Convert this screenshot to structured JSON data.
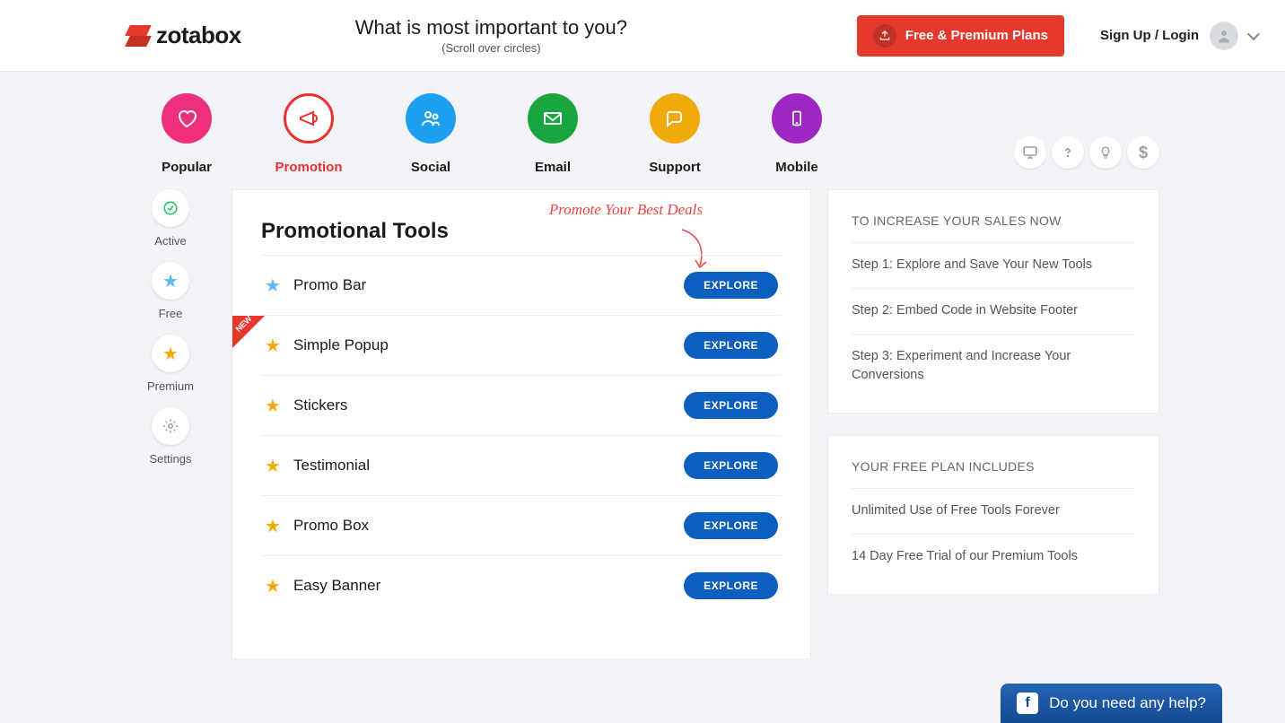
{
  "header": {
    "brand": "zotabox",
    "question": "What is most important to you?",
    "subtext": "(Scroll over circles)",
    "plans_button": "Free & Premium Plans",
    "signup_login": "Sign Up / Login"
  },
  "categories": [
    {
      "key": "popular",
      "label": "Popular",
      "active": false
    },
    {
      "key": "promotion",
      "label": "Promotion",
      "active": true
    },
    {
      "key": "social",
      "label": "Social",
      "active": false
    },
    {
      "key": "email",
      "label": "Email",
      "active": false
    },
    {
      "key": "support",
      "label": "Support",
      "active": false
    },
    {
      "key": "mobile",
      "label": "Mobile",
      "active": false
    }
  ],
  "left_rail": [
    {
      "key": "active",
      "label": "Active"
    },
    {
      "key": "free",
      "label": "Free"
    },
    {
      "key": "premium",
      "label": "Premium"
    },
    {
      "key": "settings",
      "label": "Settings"
    }
  ],
  "main": {
    "tagline": "Promote Your Best Deals",
    "heading": "Promotional Tools",
    "explore_label": "EXPLORE",
    "tools": [
      {
        "name": "Promo Bar",
        "star": "blue",
        "new": false
      },
      {
        "name": "Simple Popup",
        "star": "orange",
        "new": true
      },
      {
        "name": "Stickers",
        "star": "orange",
        "new": false
      },
      {
        "name": "Testimonial",
        "star": "orange",
        "new": false
      },
      {
        "name": "Promo Box",
        "star": "orange",
        "new": false
      },
      {
        "name": "Easy Banner",
        "star": "orange",
        "new": false
      }
    ],
    "new_badge": "NEW"
  },
  "side": {
    "increase": {
      "title": "TO INCREASE YOUR SALES NOW",
      "steps": [
        "Step 1: Explore and Save Your New Tools",
        "Step 2: Embed Code in Website Footer",
        "Step 3: Experiment and Increase Your Conversions"
      ]
    },
    "free_plan": {
      "title": "YOUR FREE PLAN INCLUDES",
      "items": [
        "Unlimited Use of Free Tools Forever",
        "14 Day Free Trial of our Premium Tools"
      ]
    }
  },
  "help": {
    "text": "Do you need any help?"
  }
}
